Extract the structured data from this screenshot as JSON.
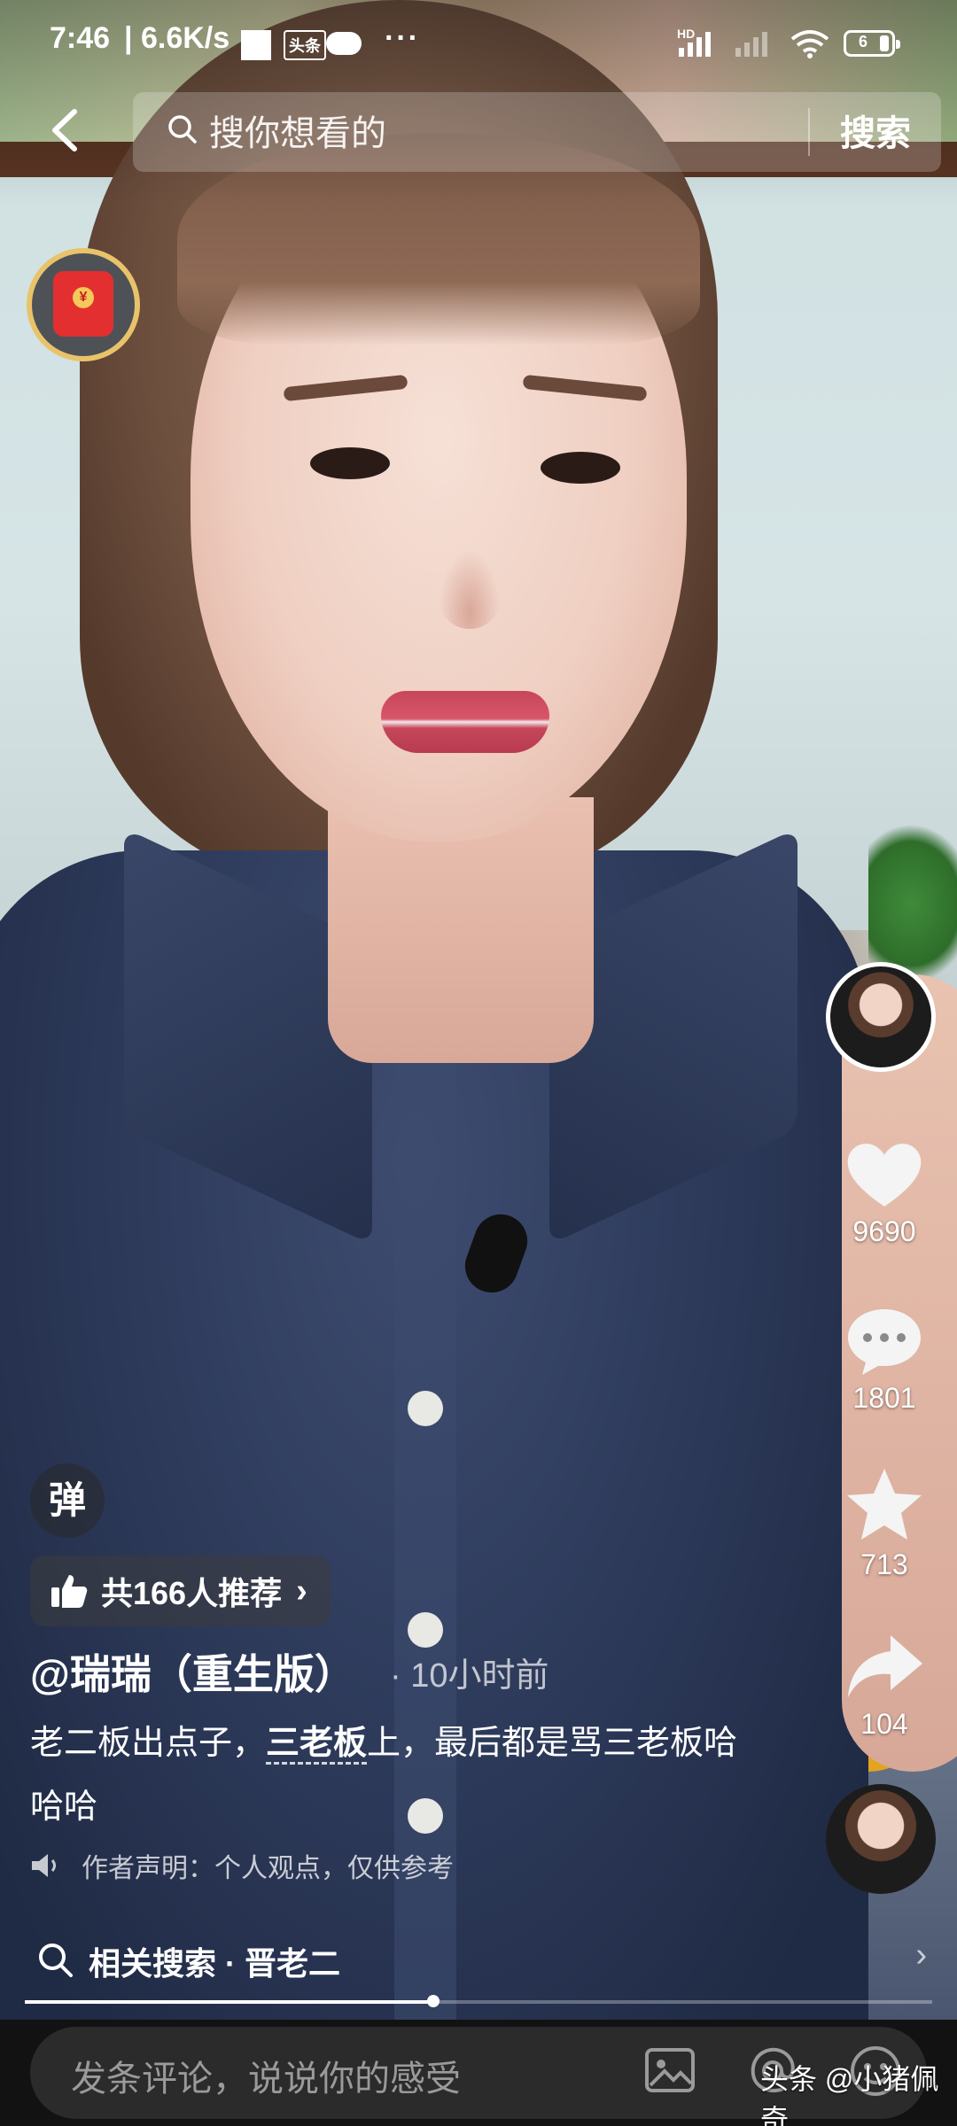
{
  "status_bar": {
    "time": "7:46",
    "network_speed": "| 6.6K/s",
    "toutiao_badge": "头条",
    "more_dots": "···",
    "hd": "HD",
    "battery_value": "6"
  },
  "search": {
    "placeholder": "搜你想看的",
    "button_label": "搜索"
  },
  "actions": {
    "likes": "9690",
    "comments": "1801",
    "favorites": "713",
    "shares": "104"
  },
  "post": {
    "danmu_label": "弹",
    "recommend": "共166人推荐",
    "author": "@瑞瑞（重生版）",
    "time_ago": "· 10小时前",
    "caption_part1": "老二板出点子，",
    "caption_highlight": "三老板",
    "caption_part2": "上，最后都是骂三老板哈哈哈",
    "disclaimer": "作者声明：个人观点，仅供参考"
  },
  "related_search": {
    "label": "相关搜索 · 晋老二"
  },
  "progress": {
    "fraction": 0.45
  },
  "comment_bar": {
    "placeholder": "发条评论，说说你的感受"
  },
  "watermark": "头条 @小猪佩奇",
  "icons": [
    "back-arrow-icon",
    "search-icon",
    "red-packet-icon",
    "heart-icon",
    "comment-icon",
    "star-icon",
    "share-icon",
    "thumbs-up-icon",
    "speaker-icon",
    "image-icon",
    "at-icon",
    "emoji-icon"
  ]
}
